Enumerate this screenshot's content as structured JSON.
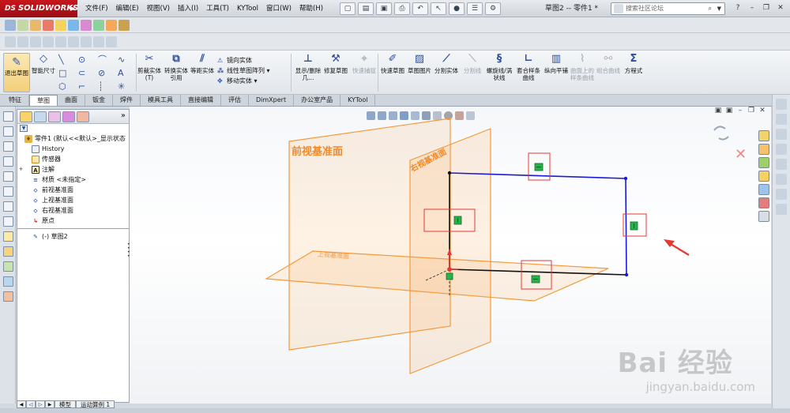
{
  "app": {
    "logo": "SOLIDWORKS",
    "menu": [
      "文件(F)",
      "编辑(E)",
      "视图(V)",
      "插入(I)",
      "工具(T)",
      "KYTool",
      "窗口(W)",
      "帮助(H)"
    ],
    "document_title": "草图2 -- 零件1 *",
    "search_placeholder": "搜索社区论坛"
  },
  "command_manager": {
    "exit_sketch": "退出草图",
    "smart_dim": "智能尺寸",
    "trim": "剪裁实体(T)",
    "convert": "转换实体引用",
    "offset": "等距实体",
    "mirror": "镜向实体",
    "linear_pattern": "线性草图阵列",
    "move": "移动实体",
    "display_delete": "显示/删除几...",
    "repair": "修复草图",
    "quick_snap": "快速捕捉",
    "rapid_sketch": "快速草图",
    "sketch_picture": "草图图片",
    "split_entity": "分割实体",
    "split_line": "分割线",
    "helix": "螺旋线/涡状线",
    "composite": "套合样条曲线",
    "parallel_plane": "纵向平铺",
    "curve_from_sketch": "曲面上的样条曲线",
    "combine_curves": "组合曲线",
    "equation": "方程式"
  },
  "tabs": [
    "特征",
    "草图",
    "曲面",
    "钣金",
    "焊件",
    "模具工具",
    "直接编辑",
    "评估",
    "DimXpert",
    "办公室产品",
    "KYTool"
  ],
  "active_tab": "草图",
  "feature_tree": [
    {
      "label": "零件1  (默认<<默认>_显示状态",
      "kind": "part"
    },
    {
      "label": "History",
      "kind": "history"
    },
    {
      "label": "传感器",
      "kind": "sensor"
    },
    {
      "label": "注解",
      "kind": "annotation",
      "expandable": true
    },
    {
      "label": "材质 <未指定>",
      "kind": "material"
    },
    {
      "label": "前视基准面",
      "kind": "plane"
    },
    {
      "label": "上视基准面",
      "kind": "plane"
    },
    {
      "label": "右视基准面",
      "kind": "plane"
    },
    {
      "label": "原点",
      "kind": "origin"
    },
    {
      "label": "(-) 草图2",
      "kind": "sketch"
    }
  ],
  "bottom_tabs": [
    "模型",
    "运动算例 1"
  ],
  "graphics": {
    "front_plane_label": "前视基准面",
    "right_plane_label": "右视基准面",
    "top_plane_label": "上视基准面",
    "relation_horizontal": "—",
    "relation_vertical": "|",
    "plane_color": "#f5a04a",
    "sketch_color": "#1b1bd6",
    "annotation_color": "#e53935"
  },
  "watermark": {
    "main": "Bai 经验",
    "sub": "jingyan.baidu.com"
  }
}
